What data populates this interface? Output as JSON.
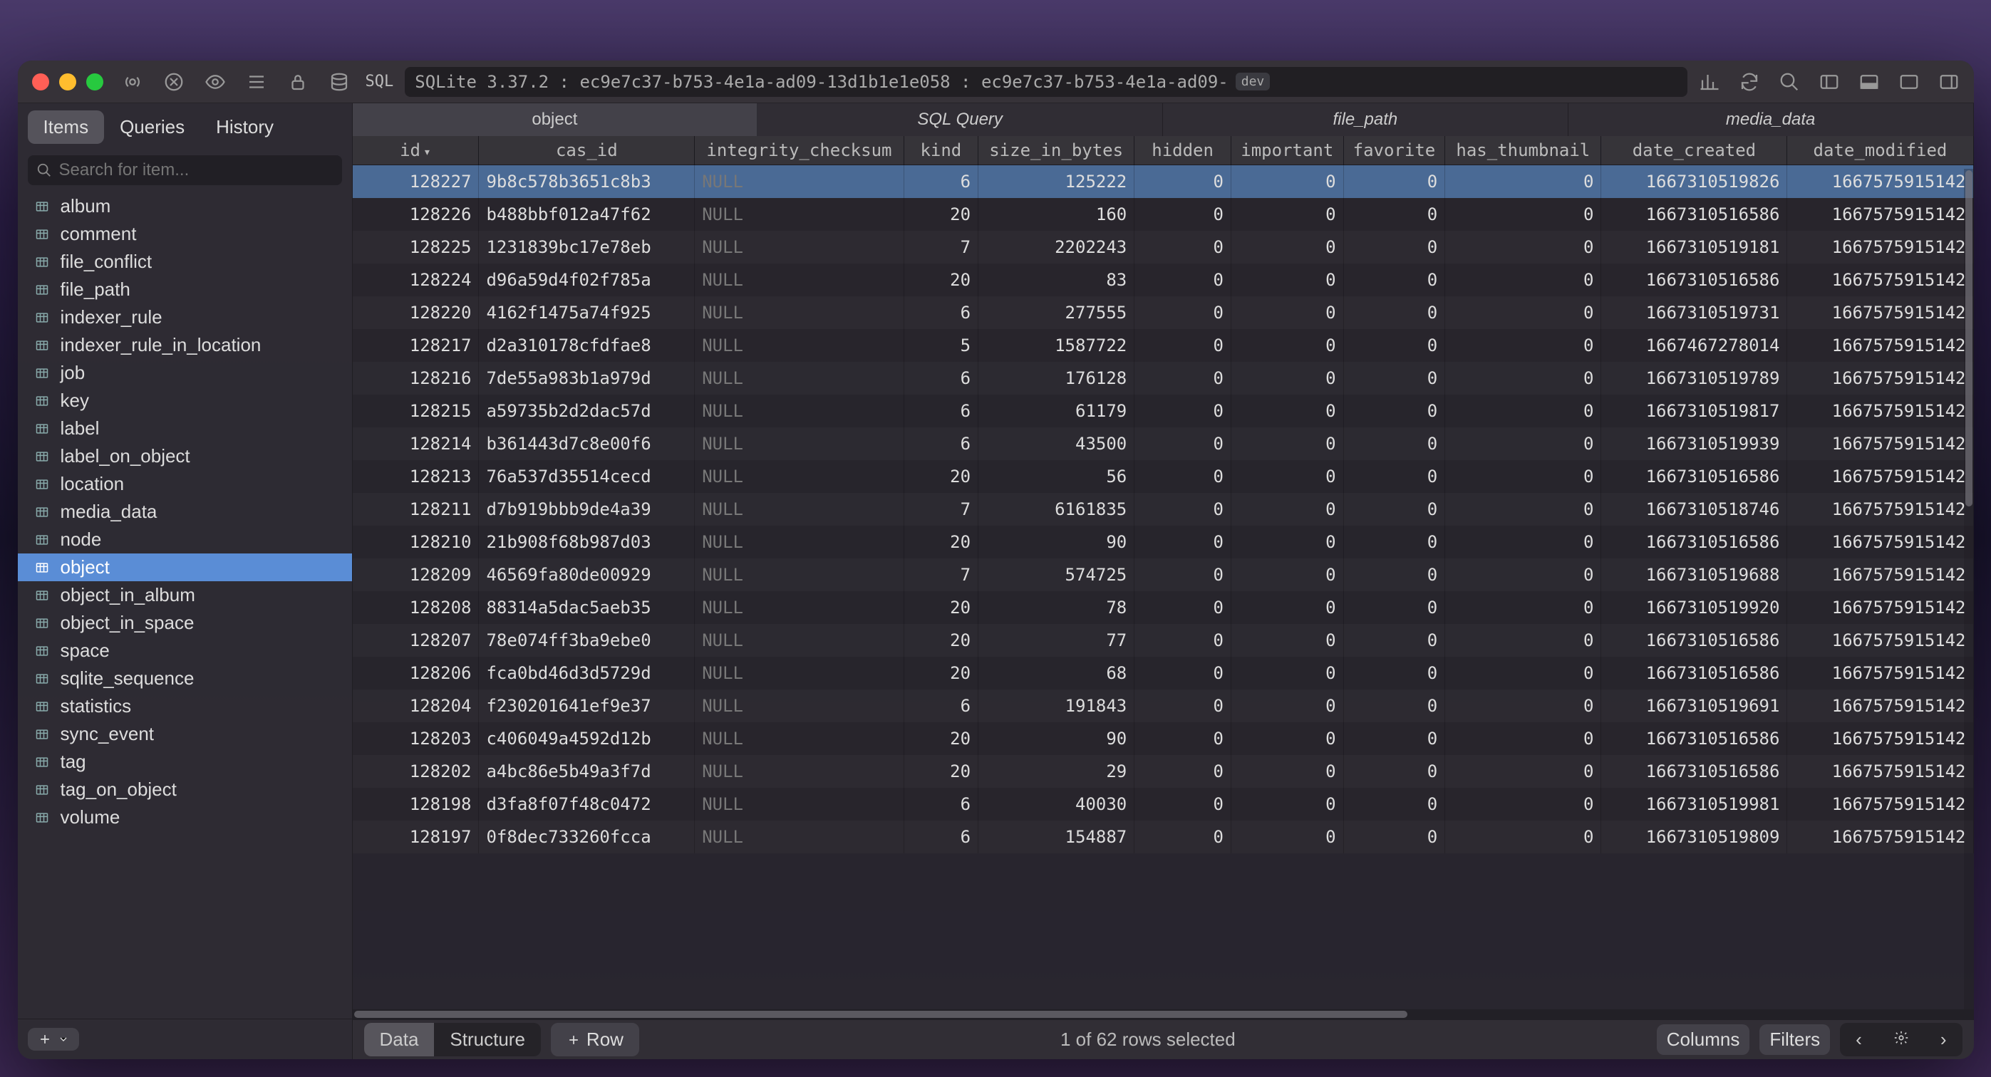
{
  "titlebar": {
    "sql_label": "SQL",
    "path": "SQLite 3.37.2 : ec9e7c37-b753-4e1a-ad09-13d1b1e1e058 : ec9e7c37-b753-4e1a-ad09-",
    "dev_badge": "dev"
  },
  "sidebar": {
    "tabs": [
      "Items",
      "Queries",
      "History"
    ],
    "active_tab": 0,
    "search_placeholder": "Search for item...",
    "items": [
      "album",
      "comment",
      "file_conflict",
      "file_path",
      "indexer_rule",
      "indexer_rule_in_location",
      "job",
      "key",
      "label",
      "label_on_object",
      "location",
      "media_data",
      "node",
      "object",
      "object_in_album",
      "object_in_space",
      "space",
      "sqlite_sequence",
      "statistics",
      "sync_event",
      "tag",
      "tag_on_object",
      "volume"
    ],
    "selected_item": "object"
  },
  "main_tabs": [
    "object",
    "SQL Query",
    "file_path",
    "media_data"
  ],
  "main_tab_active": 0,
  "columns": [
    "id",
    "cas_id",
    "integrity_checksum",
    "kind",
    "size_in_bytes",
    "hidden",
    "important",
    "favorite",
    "has_thumbnail",
    "date_created",
    "date_modified"
  ],
  "sort_col": "id",
  "sort_dir": "desc",
  "rows": [
    {
      "id": 128227,
      "cas_id": "9b8c578b3651c8b3",
      "integrity_checksum": null,
      "kind": 6,
      "size_in_bytes": 125222,
      "hidden": 0,
      "important": 0,
      "favorite": 0,
      "has_thumbnail": 0,
      "date_created": 1667310519826,
      "date_modified": 1667575915142,
      "selected": true
    },
    {
      "id": 128226,
      "cas_id": "b488bbf012a47f62",
      "integrity_checksum": "NULL",
      "kind": 20,
      "size_in_bytes": 160,
      "hidden": 0,
      "important": 0,
      "favorite": 0,
      "has_thumbnail": 0,
      "date_created": 1667310516586,
      "date_modified": 1667575915142
    },
    {
      "id": 128225,
      "cas_id": "1231839bc17e78eb",
      "integrity_checksum": "NULL",
      "kind": 7,
      "size_in_bytes": 2202243,
      "hidden": 0,
      "important": 0,
      "favorite": 0,
      "has_thumbnail": 0,
      "date_created": 1667310519181,
      "date_modified": 1667575915142
    },
    {
      "id": 128224,
      "cas_id": "d96a59d4f02f785a",
      "integrity_checksum": "NULL",
      "kind": 20,
      "size_in_bytes": 83,
      "hidden": 0,
      "important": 0,
      "favorite": 0,
      "has_thumbnail": 0,
      "date_created": 1667310516586,
      "date_modified": 1667575915142
    },
    {
      "id": 128220,
      "cas_id": "4162f1475a74f925",
      "integrity_checksum": "NULL",
      "kind": 6,
      "size_in_bytes": 277555,
      "hidden": 0,
      "important": 0,
      "favorite": 0,
      "has_thumbnail": 0,
      "date_created": 1667310519731,
      "date_modified": 1667575915142
    },
    {
      "id": 128217,
      "cas_id": "d2a310178cfdfae8",
      "integrity_checksum": "NULL",
      "kind": 5,
      "size_in_bytes": 1587722,
      "hidden": 0,
      "important": 0,
      "favorite": 0,
      "has_thumbnail": 0,
      "date_created": 1667467278014,
      "date_modified": 1667575915142
    },
    {
      "id": 128216,
      "cas_id": "7de55a983b1a979d",
      "integrity_checksum": "NULL",
      "kind": 6,
      "size_in_bytes": 176128,
      "hidden": 0,
      "important": 0,
      "favorite": 0,
      "has_thumbnail": 0,
      "date_created": 1667310519789,
      "date_modified": 1667575915142
    },
    {
      "id": 128215,
      "cas_id": "a59735b2d2dac57d",
      "integrity_checksum": "NULL",
      "kind": 6,
      "size_in_bytes": 61179,
      "hidden": 0,
      "important": 0,
      "favorite": 0,
      "has_thumbnail": 0,
      "date_created": 1667310519817,
      "date_modified": 1667575915142
    },
    {
      "id": 128214,
      "cas_id": "b361443d7c8e00f6",
      "integrity_checksum": "NULL",
      "kind": 6,
      "size_in_bytes": 43500,
      "hidden": 0,
      "important": 0,
      "favorite": 0,
      "has_thumbnail": 0,
      "date_created": 1667310519939,
      "date_modified": 1667575915142
    },
    {
      "id": 128213,
      "cas_id": "76a537d35514cecd",
      "integrity_checksum": "NULL",
      "kind": 20,
      "size_in_bytes": 56,
      "hidden": 0,
      "important": 0,
      "favorite": 0,
      "has_thumbnail": 0,
      "date_created": 1667310516586,
      "date_modified": 1667575915142
    },
    {
      "id": 128211,
      "cas_id": "d7b919bbb9de4a39",
      "integrity_checksum": "NULL",
      "kind": 7,
      "size_in_bytes": 6161835,
      "hidden": 0,
      "important": 0,
      "favorite": 0,
      "has_thumbnail": 0,
      "date_created": 1667310518746,
      "date_modified": 1667575915142
    },
    {
      "id": 128210,
      "cas_id": "21b908f68b987d03",
      "integrity_checksum": "NULL",
      "kind": 20,
      "size_in_bytes": 90,
      "hidden": 0,
      "important": 0,
      "favorite": 0,
      "has_thumbnail": 0,
      "date_created": 1667310516586,
      "date_modified": 1667575915142
    },
    {
      "id": 128209,
      "cas_id": "46569fa80de00929",
      "integrity_checksum": "NULL",
      "kind": 7,
      "size_in_bytes": 574725,
      "hidden": 0,
      "important": 0,
      "favorite": 0,
      "has_thumbnail": 0,
      "date_created": 1667310519688,
      "date_modified": 1667575915142
    },
    {
      "id": 128208,
      "cas_id": "88314a5dac5aeb35",
      "integrity_checksum": "NULL",
      "kind": 20,
      "size_in_bytes": 78,
      "hidden": 0,
      "important": 0,
      "favorite": 0,
      "has_thumbnail": 0,
      "date_created": 1667310519920,
      "date_modified": 1667575915142
    },
    {
      "id": 128207,
      "cas_id": "78e074ff3ba9ebe0",
      "integrity_checksum": "NULL",
      "kind": 20,
      "size_in_bytes": 77,
      "hidden": 0,
      "important": 0,
      "favorite": 0,
      "has_thumbnail": 0,
      "date_created": 1667310516586,
      "date_modified": 1667575915142
    },
    {
      "id": 128206,
      "cas_id": "fca0bd46d3d5729d",
      "integrity_checksum": "NULL",
      "kind": 20,
      "size_in_bytes": 68,
      "hidden": 0,
      "important": 0,
      "favorite": 0,
      "has_thumbnail": 0,
      "date_created": 1667310516586,
      "date_modified": 1667575915142
    },
    {
      "id": 128204,
      "cas_id": "f230201641ef9e37",
      "integrity_checksum": "NULL",
      "kind": 6,
      "size_in_bytes": 191843,
      "hidden": 0,
      "important": 0,
      "favorite": 0,
      "has_thumbnail": 0,
      "date_created": 1667310519691,
      "date_modified": 1667575915142
    },
    {
      "id": 128203,
      "cas_id": "c406049a4592d12b",
      "integrity_checksum": "NULL",
      "kind": 20,
      "size_in_bytes": 90,
      "hidden": 0,
      "important": 0,
      "favorite": 0,
      "has_thumbnail": 0,
      "date_created": 1667310516586,
      "date_modified": 1667575915142
    },
    {
      "id": 128202,
      "cas_id": "a4bc86e5b49a3f7d",
      "integrity_checksum": "NULL",
      "kind": 20,
      "size_in_bytes": 29,
      "hidden": 0,
      "important": 0,
      "favorite": 0,
      "has_thumbnail": 0,
      "date_created": 1667310516586,
      "date_modified": 1667575915142
    },
    {
      "id": 128198,
      "cas_id": "d3fa8f07f48c0472",
      "integrity_checksum": "NULL",
      "kind": 6,
      "size_in_bytes": 40030,
      "hidden": 0,
      "important": 0,
      "favorite": 0,
      "has_thumbnail": 0,
      "date_created": 1667310519981,
      "date_modified": 1667575915142
    },
    {
      "id": 128197,
      "cas_id": "0f8dec733260fcca",
      "integrity_checksum": "NULL",
      "kind": 6,
      "size_in_bytes": 154887,
      "hidden": 0,
      "important": 0,
      "favorite": 0,
      "has_thumbnail": 0,
      "date_created": 1667310519809,
      "date_modified": 1667575915142
    }
  ],
  "footer": {
    "seg": [
      "Data",
      "Structure"
    ],
    "seg_active": 0,
    "row_btn": "Row",
    "status": "1 of 62 rows selected",
    "columns_btn": "Columns",
    "filters_btn": "Filters"
  }
}
